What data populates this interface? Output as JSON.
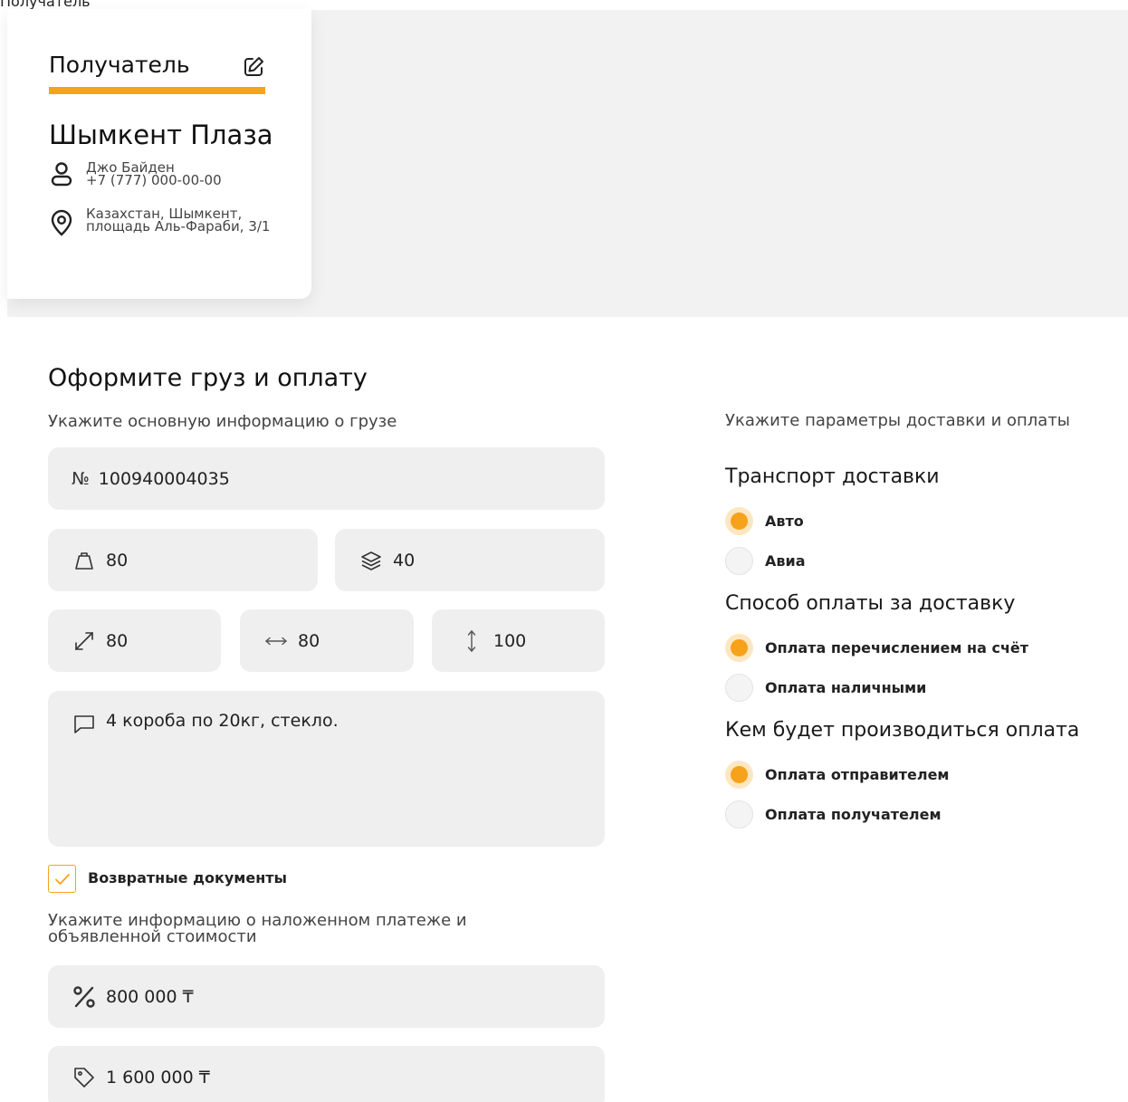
{
  "top_cut_text": "Получатель",
  "recipient": {
    "title": "Получатель",
    "company": "Шымкент Плаза",
    "contact_name": "Джо Байден",
    "contact_phone": "+7 (777) 000-00-00",
    "address": "Казахстан, Шымкент, площадь Аль-Фараби, 3/1"
  },
  "form": {
    "title": "Оформите груз и оплату",
    "cargo_subtitle": "Укажите основную информацию о грузе",
    "number_prefix": "№",
    "number": "100940004035",
    "weight": "80",
    "volume": "40",
    "length": "80",
    "width": "80",
    "height": "100",
    "comment": "4 короба по 20кг, стекло.",
    "return_docs_label": "Возвратные документы",
    "return_docs_checked": true,
    "payment_subtitle": "Укажите информацию о наложенном платеже и объявленной стоимости",
    "cod_amount": "800 000 ₸",
    "declared_value": "1 600 000 ₸"
  },
  "delivery": {
    "subtitle": "Укажите параметры доставки и оплаты",
    "transport_title": "Транспорт доставки",
    "transport_options": [
      {
        "label": "Авто",
        "selected": true
      },
      {
        "label": "Авиа",
        "selected": false
      }
    ],
    "payment_method_title": "Способ оплаты за доставку",
    "payment_method_options": [
      {
        "label": "Оплата перечислением на счёт",
        "selected": true
      },
      {
        "label": "Оплата наличными",
        "selected": false
      }
    ],
    "payer_title": "Кем будет производиться оплата",
    "payer_options": [
      {
        "label": "Оплата отправителем",
        "selected": true
      },
      {
        "label": "Оплата получателем",
        "selected": false
      }
    ]
  },
  "colors": {
    "accent": "#f7a21b",
    "field_bg": "#efefef",
    "band_bg": "#f2f2f2"
  }
}
